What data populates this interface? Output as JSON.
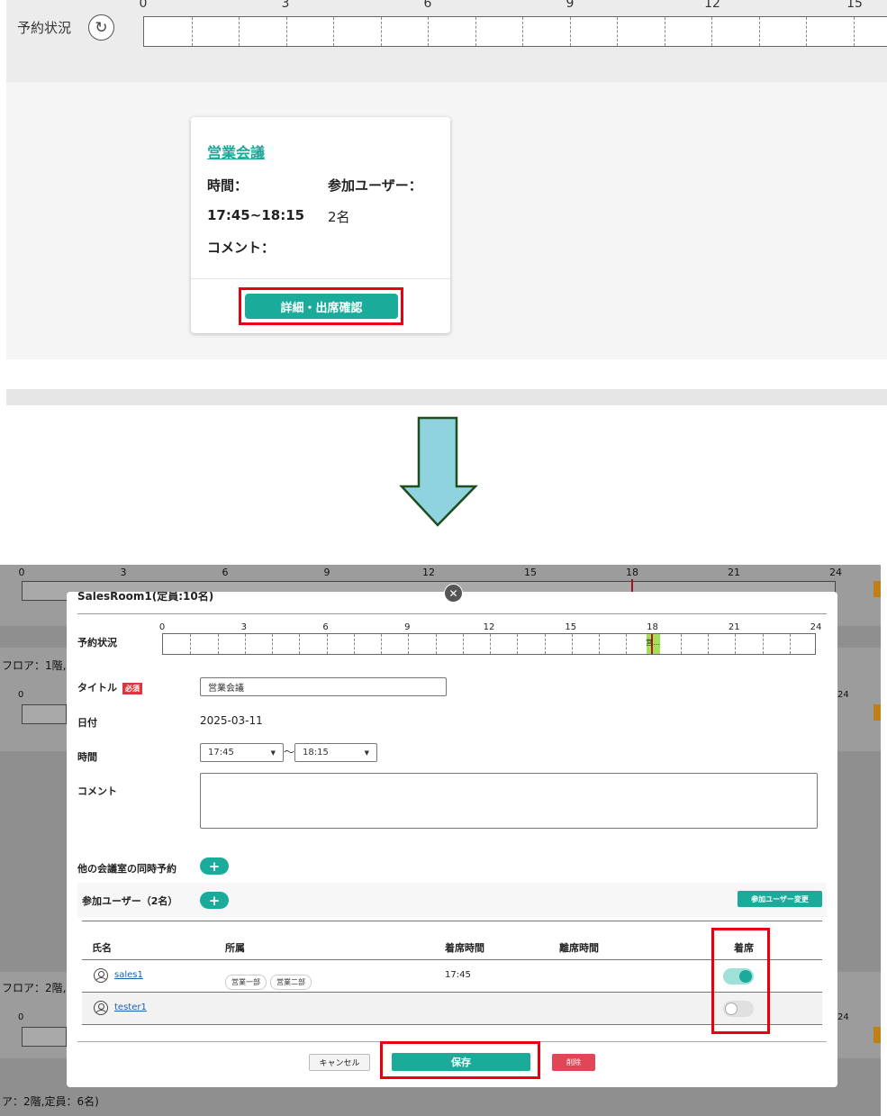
{
  "top": {
    "timeline_label": "予約状況",
    "refresh_icon": "refresh-icon",
    "ticks": [
      "0",
      "3",
      "6",
      "9",
      "12",
      "15"
    ],
    "card": {
      "title": "営業会議",
      "time_label": "時間：",
      "time_value": "17:45~18:15",
      "participants_label": "参加ユーザー：",
      "participants_value": "2名",
      "comment_label": "コメント：",
      "button_label": "詳細・出席確認"
    }
  },
  "arrow": {
    "icon": "down-arrow-icon",
    "fill": "#8fd3df",
    "stroke": "#1e4d1e"
  },
  "background_page": {
    "ticks": [
      "0",
      "3",
      "6",
      "9",
      "12",
      "15",
      "18",
      "21",
      "24"
    ],
    "floor_text_1": "フロア：1階,",
    "floor_text_2": "フロア：2階,",
    "floor_text_3": "ア：2階,定員：6名)",
    "tick_0": "0",
    "tick_24": "24"
  },
  "modal": {
    "room_title": "SalesRoom1(定員:10名)",
    "close_icon": "close-icon",
    "timeline_label": "予約状況",
    "ticks": [
      "0",
      "3",
      "6",
      "9",
      "12",
      "15",
      "18",
      "21",
      "24"
    ],
    "booking_label": "営…",
    "title_label": "タイトル",
    "required_badge": "必須",
    "title_value": "営業会議",
    "date_label": "日付",
    "date_value": "2025-03-11",
    "time_label": "時間",
    "start_time": "17:45",
    "time_separator": "〜",
    "end_time": "18:15",
    "comment_label": "コメント",
    "comment_value": "",
    "other_rooms_label": "他の会議室の同時予約",
    "participants_label": "参加ユーザー（2名）",
    "change_users_button": "参加ユーザー変更",
    "columns": {
      "name": "氏名",
      "department": "所属",
      "checkin_time": "着席時間",
      "checkout_time": "離席時間",
      "seated": "着席"
    },
    "users": [
      {
        "name": "sales1",
        "departments": [
          "営業一部",
          "営業二部"
        ],
        "checkin": "17:45",
        "checkout": "",
        "seated": true
      },
      {
        "name": "tester1",
        "departments": [],
        "checkin": "",
        "checkout": "",
        "seated": false
      }
    ],
    "buttons": {
      "cancel": "キャンセル",
      "save": "保存",
      "delete": "削除"
    },
    "colors": {
      "accent": "#1aab9b",
      "highlight": "#e60012",
      "delete": "#e04656"
    }
  }
}
